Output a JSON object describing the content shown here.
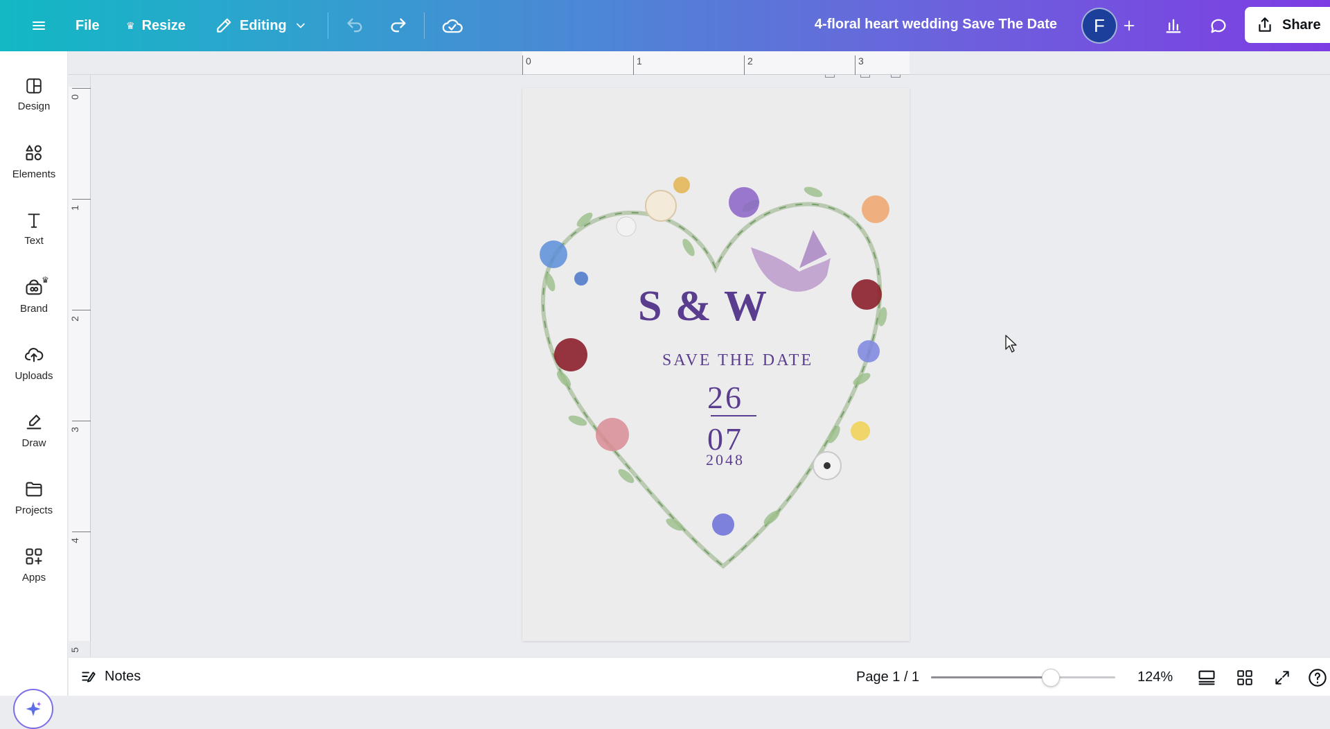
{
  "topbar": {
    "file_label": "File",
    "resize_label": "Resize",
    "editing_label": "Editing",
    "doc_title": "4-floral heart wedding Save The Date",
    "avatar_initial": "F",
    "share_label": "Share"
  },
  "sidebar": {
    "items": [
      {
        "label": "Design",
        "icon": "design-icon"
      },
      {
        "label": "Elements",
        "icon": "elements-icon"
      },
      {
        "label": "Text",
        "icon": "text-icon"
      },
      {
        "label": "Brand",
        "icon": "brand-icon"
      },
      {
        "label": "Uploads",
        "icon": "uploads-icon"
      },
      {
        "label": "Draw",
        "icon": "draw-icon"
      },
      {
        "label": "Projects",
        "icon": "projects-icon"
      },
      {
        "label": "Apps",
        "icon": "apps-icon"
      }
    ]
  },
  "rulers": {
    "top": [
      "0",
      "1",
      "2",
      "3"
    ],
    "left": [
      "0",
      "1",
      "2",
      "3",
      "4",
      "5"
    ]
  },
  "design": {
    "monogram": "S & W",
    "headline": "SAVE THE DATE",
    "day": "26",
    "month": "07",
    "year": "2048"
  },
  "bottombar": {
    "notes_label": "Notes",
    "page_info": "Page 1 / 1",
    "zoom_label": "124%",
    "zoom_slider_fraction": 0.65
  },
  "colors": {
    "accent_purple": "#5a3d8e",
    "avatar_bg": "#1b3f9a",
    "topbar_start": "#12b8c4",
    "topbar_end": "#7d3de3"
  }
}
